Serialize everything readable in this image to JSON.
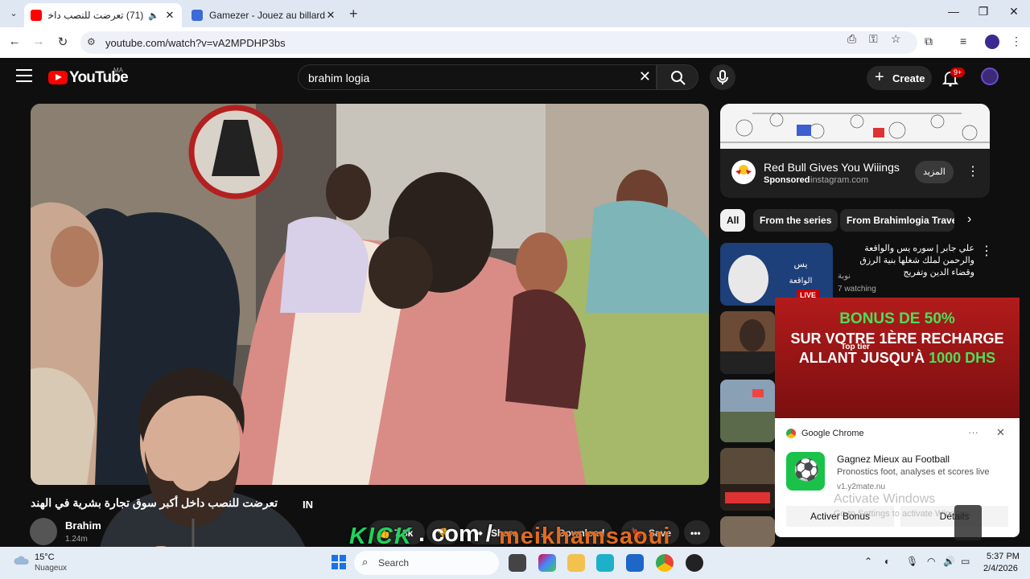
{
  "browser": {
    "tabs": [
      {
        "title": "(71) تعرضت للنصب داخل أكـ",
        "active": true
      },
      {
        "title": "Gamezer - Jouez au billard, aux",
        "active": false
      }
    ],
    "url": "youtube.com/watch?v=vA2MPDHP3bs"
  },
  "youtube": {
    "logo": "YouTube",
    "country": "MA",
    "search_query": "brahim logia",
    "create_label": "Create",
    "notifications": "9+"
  },
  "video": {
    "title_ar": "تعرضت للنصب داخل أكبر سوق تجارة بشرية في الهند",
    "title_suffix": "IN",
    "channel_name": "Brahim",
    "channel_subs": "1.24m",
    "likes": "7.8k",
    "share_label": "Share",
    "download_label": "Download",
    "save_label": "Save"
  },
  "stream_overlay": {
    "kick": "KICK",
    "dot": ". com /",
    "user": "meikhamsaoui"
  },
  "ad": {
    "title": "Red Bull Gives You Wiiings",
    "sponsored": "Sponsored",
    "domain": "instagram.com",
    "more_label": "المزيد"
  },
  "chips": [
    "All",
    "From the series",
    "From Brahimlogia Travels"
  ],
  "recommendations": [
    {
      "title": "علي جابر | سوره يس والواقعة والرحمن لملك شغلها بنية الرزق وقضاء الدين وتفريج",
      "channel": "نوبة",
      "meta": "7 watching",
      "live": "LIVE"
    }
  ],
  "bonus_ad": {
    "line1": "BONUS DE 50%",
    "line2": "SUR VOTRE 1ÈRE RECHARGE",
    "line3_pre": "ALLANT JUSQU'À",
    "line3_amt": "1000 DHS",
    "top_tier": "Top tier"
  },
  "notification": {
    "app": "Google Chrome",
    "title": "Gagnez Mieux au Football",
    "body": "Pronostics foot, analyses et scores live",
    "source": "v1.y2mate.nu",
    "action1": "Activer Bonus",
    "action2": "Détails"
  },
  "windows_watermark": {
    "line1": "Activate Windows",
    "line2": "Go to Settings to activate Windows."
  },
  "taskbar": {
    "temp": "15°C",
    "weather": "Nuageux",
    "search_placeholder": "Search",
    "time": "5:37 PM",
    "date": "2/4/2026"
  },
  "colors": {
    "yt_red": "#ff0000",
    "kick_green": "#1fd35d",
    "user_orange": "#e36a1f",
    "bonus_red": "#b21b1b",
    "bonus_green": "#48e05a"
  }
}
